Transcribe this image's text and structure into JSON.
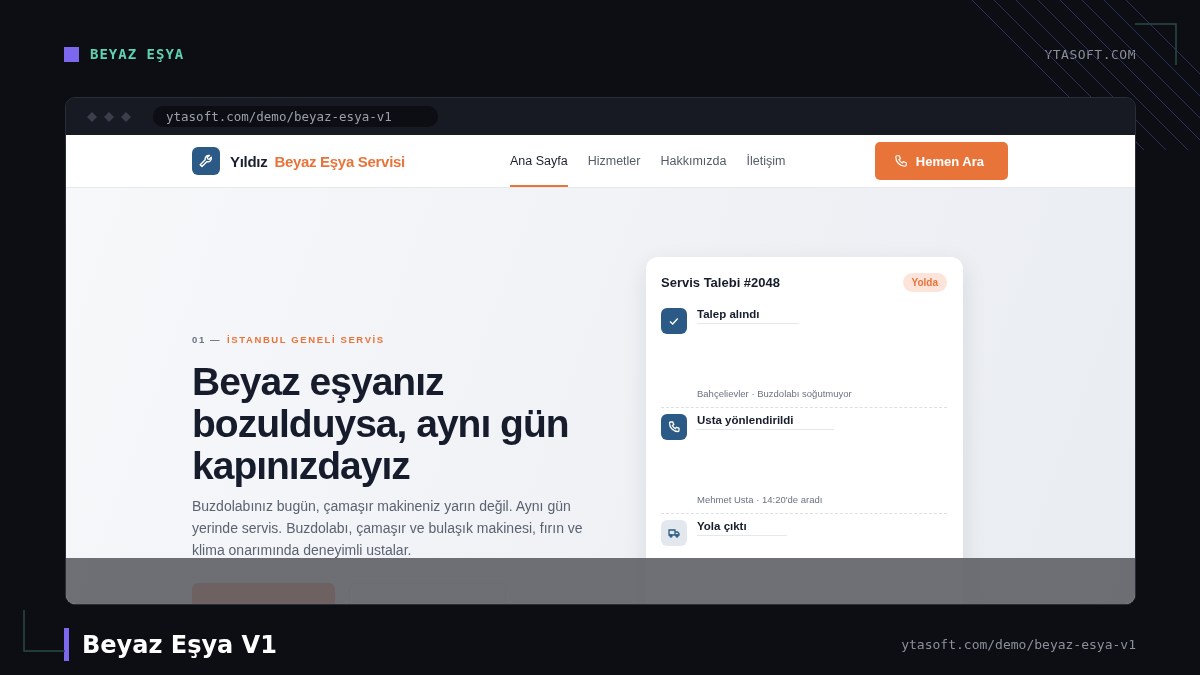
{
  "header": {
    "tag": "BEYAZ EŞYA",
    "site": "YTASOFT.COM"
  },
  "browser": {
    "url": "ytasoft.com/demo/beyaz-esya-v1"
  },
  "site": {
    "brand_dark": "Yıldız",
    "brand_accent": "Beyaz Eşya Servisi",
    "call_button": "Hemen Ara",
    "nav": [
      {
        "label": "Ana Sayfa",
        "selected": true
      },
      {
        "label": "Hizmetler",
        "selected": false
      },
      {
        "label": "Hakkımızda",
        "selected": false
      },
      {
        "label": "İletişim",
        "selected": false
      }
    ]
  },
  "hero": {
    "eyebrow_number": "01 —",
    "eyebrow": "İSTANBUL GENELİ SERVİS",
    "title_lines": [
      "Beyaz eşyanız",
      "bozulduysa, aynı gün",
      "kapınızdayız"
    ],
    "description": "Buzdolabınız bugün, çamaşır makineniz yarın değil. Aynı gün yerinde servis. Buzdolabı, çamaşır ve bulaşık makinesi, fırın ve klima onarımında deneyimli ustalar."
  },
  "card": {
    "title": "Servis Talebi #2048",
    "status": "Yolda",
    "steps": [
      {
        "kind": "check",
        "title": "Talep alındı",
        "detail": "Bahçelievler · Buzdolabı soğutmuyor",
        "done": true
      },
      {
        "kind": "phone",
        "title": "Usta yönlendirildi",
        "detail": "Mehmet Usta · 14:20'de aradı",
        "done": true
      },
      {
        "kind": "truck",
        "title": "Yola çıktı",
        "done": false
      }
    ]
  },
  "footer": {
    "title": "Beyaz Eşya V1",
    "url": "ytasoft.com/demo/beyaz-esya-v1"
  }
}
